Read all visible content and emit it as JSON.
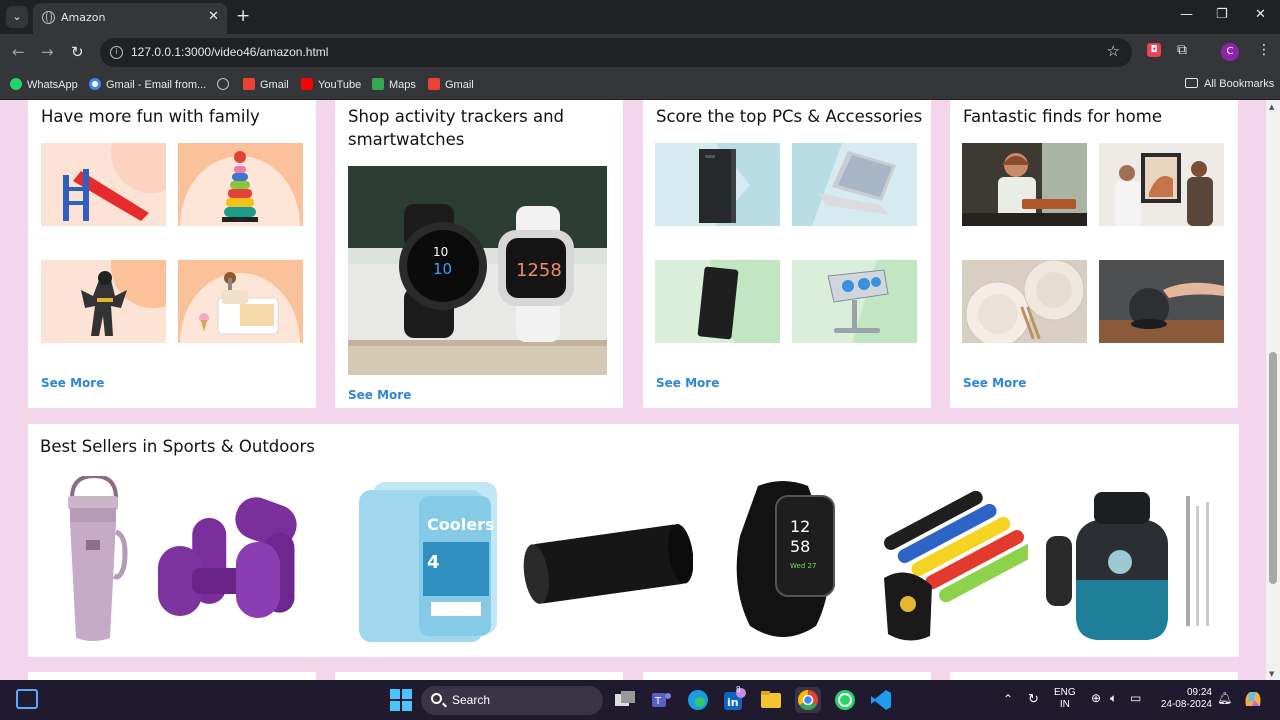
{
  "browser": {
    "tab_title": "Amazon",
    "url": "127.0.0.1:3000/video46/amazon.html",
    "profile_initial": "C",
    "bookmarks": [
      {
        "label": "WhatsApp",
        "color": "#25d366"
      },
      {
        "label": "Gmail - Email from...",
        "color": "#ffffff"
      },
      {
        "label": "",
        "color": "#bdc1c6"
      },
      {
        "label": "Gmail",
        "color": "#ea4335"
      },
      {
        "label": "YouTube",
        "color": "#ff0000"
      },
      {
        "label": "Maps",
        "color": "#34a853"
      },
      {
        "label": "Gmail",
        "color": "#ea4335"
      }
    ],
    "all_bookmarks": "All Bookmarks"
  },
  "cards": [
    {
      "title": "Have more fun with family",
      "see_more": "See More"
    },
    {
      "title": "Shop activity trackers and smartwatches",
      "see_more": "See More"
    },
    {
      "title": "Score the top PCs & Accessories",
      "see_more": "See More"
    },
    {
      "title": "Fantastic finds for home",
      "see_more": "See More"
    }
  ],
  "best_sellers": {
    "title": "Best Sellers in Sports & Outdoors",
    "products": [
      "tumbler",
      "dumbbells",
      "ice-packs",
      "foam-roller",
      "fitness-tracker",
      "resistance-bands",
      "water-bottle"
    ]
  },
  "taskbar": {
    "search": "Search",
    "lang_line1": "ENG",
    "lang_line2": "IN",
    "time": "09:24",
    "date": "24-08-2024",
    "linkedin_badge": "8"
  },
  "colors": {
    "page_bg": "#f3d5ec",
    "see_more": "#2f86d6"
  }
}
